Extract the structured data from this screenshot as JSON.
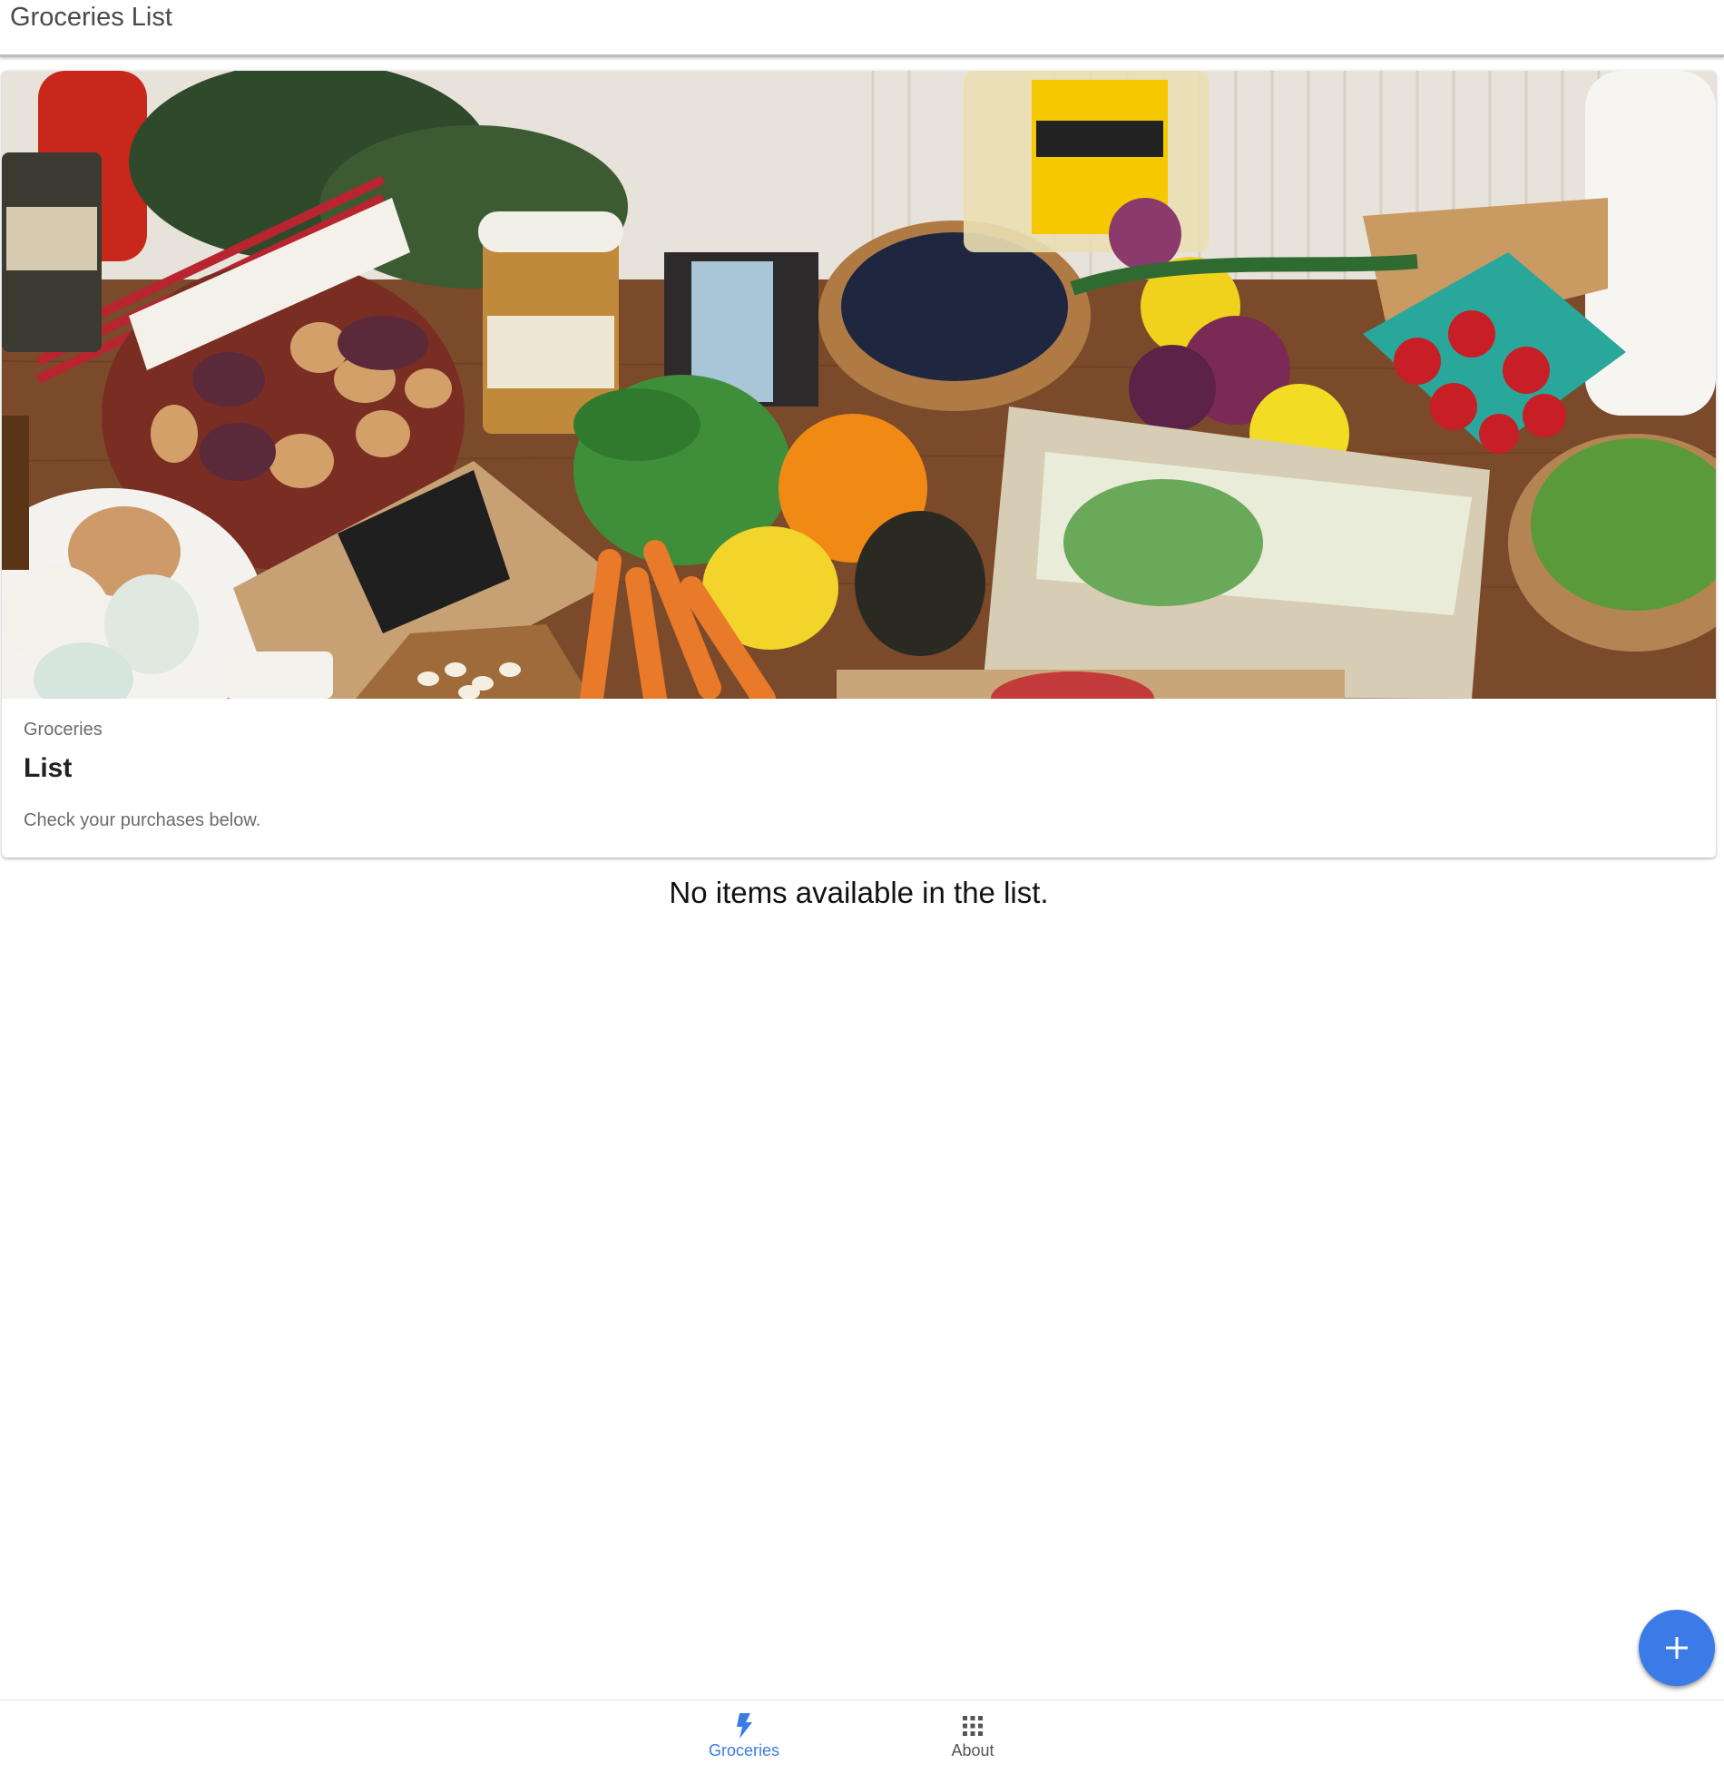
{
  "app_bar": {
    "title": "Groceries List"
  },
  "card": {
    "image_alt": "Assorted groceries on a wooden table",
    "subtitle": "Groceries",
    "title": "List",
    "text": "Check your purchases below."
  },
  "list": {
    "empty_message": "No items available in the list."
  },
  "fab": {
    "icon": "plus-icon",
    "color": "#3a7be8"
  },
  "bottom_nav": {
    "items": [
      {
        "label": "Groceries",
        "icon": "bolt-icon",
        "active": true
      },
      {
        "label": "About",
        "icon": "grid-icon",
        "active": false
      }
    ],
    "active_color": "#3a7be8"
  }
}
